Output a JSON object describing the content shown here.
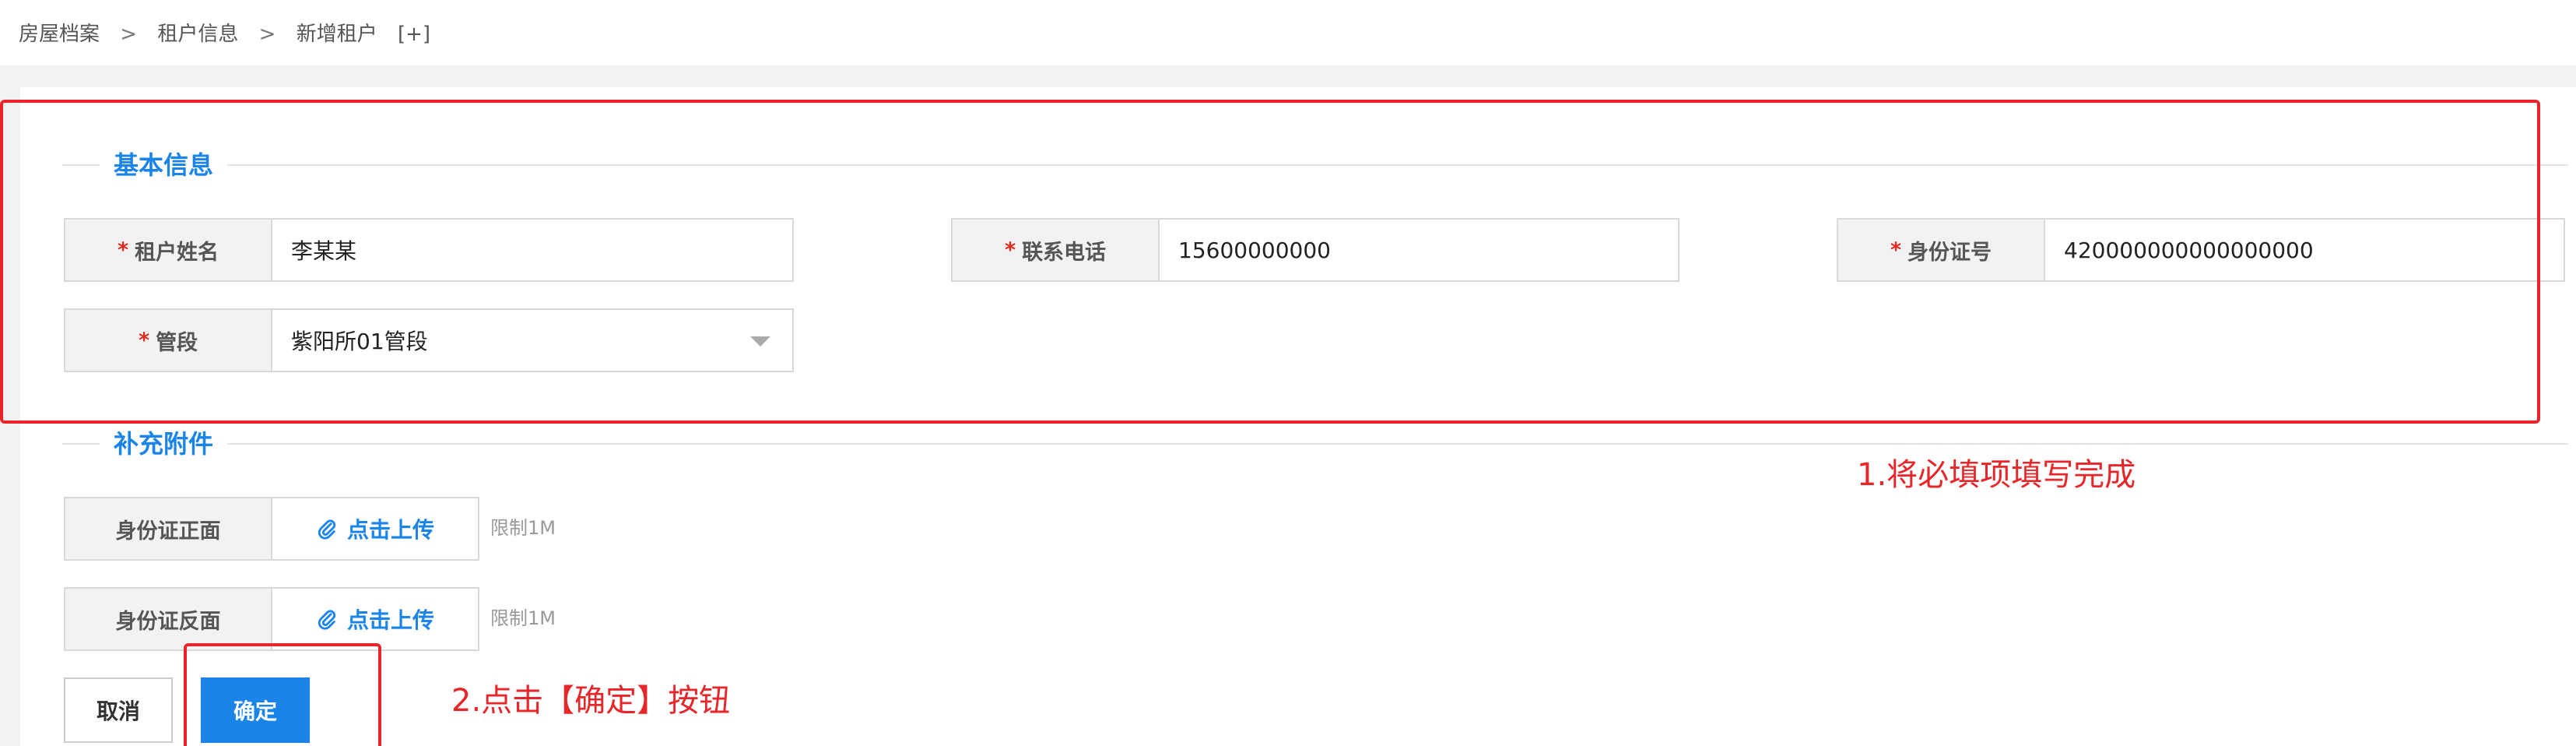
{
  "breadcrumb": {
    "items": [
      "房屋档案",
      "租户信息",
      "新增租户"
    ],
    "separator": ">",
    "add_tab": "[+]"
  },
  "basic_info": {
    "title": "基本信息",
    "required_mark": "*",
    "tenant_name": {
      "label": "租户姓名",
      "value": "李某某"
    },
    "phone": {
      "label": "联系电话",
      "value": "15600000000"
    },
    "id_number": {
      "label": "身份证号",
      "value": "420000000000000000"
    },
    "district": {
      "label": "管段",
      "value": "紫阳所01管段"
    }
  },
  "attachments": {
    "title": "补充附件",
    "id_front": {
      "label": "身份证正面",
      "button": "点击上传",
      "limit": "限制1M"
    },
    "id_back": {
      "label": "身份证反面",
      "button": "点击上传",
      "limit": "限制1M"
    }
  },
  "actions": {
    "cancel": "取消",
    "confirm": "确定"
  },
  "annotations": {
    "step1": "1.将必填项填写完成",
    "step2": "2.点击【确定】按钮"
  },
  "colors": {
    "accent": "#1a84e8",
    "required": "#e0281d",
    "annotation": "#e8262a"
  },
  "icons": {
    "upload": "paperclip-icon",
    "select": "chevron-down-icon"
  }
}
